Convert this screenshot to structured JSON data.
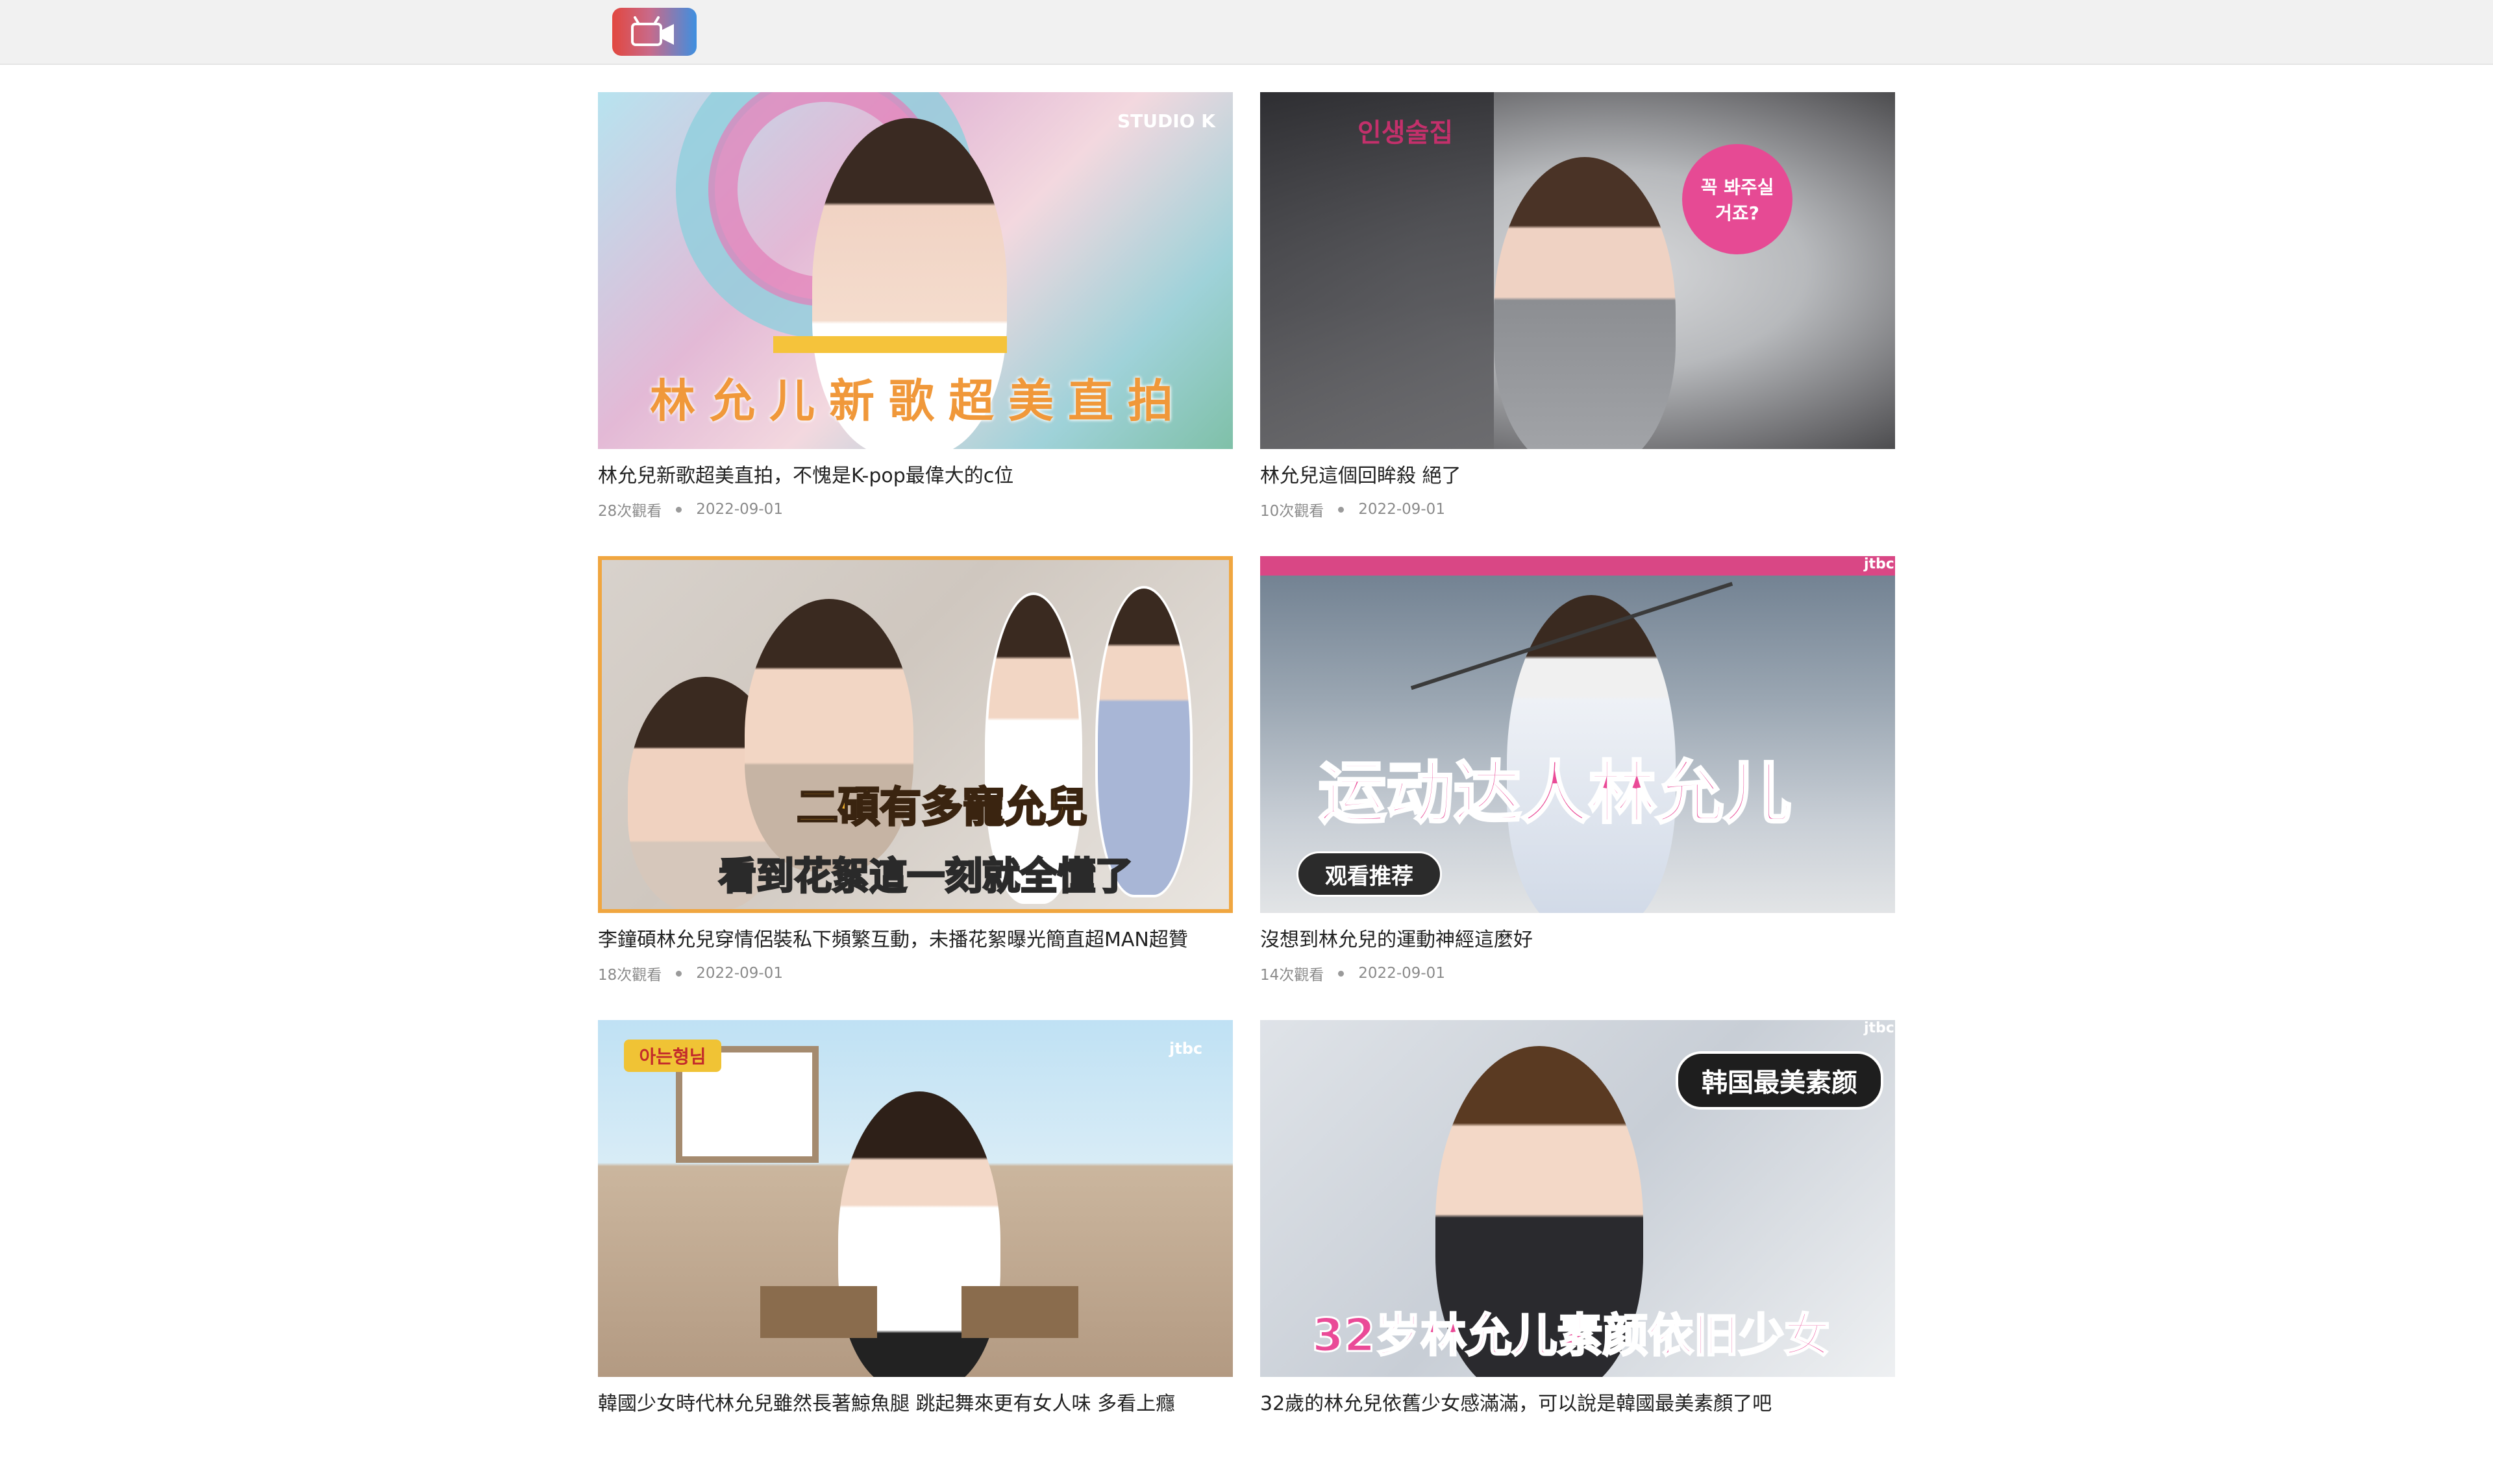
{
  "header": {
    "logo_icon": "video-camera-icon",
    "logo_colors": [
      "#e2473f",
      "#3e8fe0"
    ]
  },
  "videos": [
    {
      "title": "林允兒新歌超美直拍，不愧是K-pop最偉大的c位",
      "views": "28次觀看",
      "date": "2022-09-01",
      "overlay": "林允儿新歌超美直拍",
      "logo_text": "STUDIO K"
    },
    {
      "title": "林允兒這個回眸殺 絕了",
      "views": "10次觀看",
      "date": "2022-09-01",
      "overlay": "인생술집",
      "bubble": "꼭 봐주실 거죠?"
    },
    {
      "title": "李鐘碩林允兒穿情侶裝私下頻繁互動，未播花絮曝光簡直超MAN超贊",
      "views": "18次觀看",
      "date": "2022-09-01",
      "overlay_line1": "二碩有多寵允兒",
      "overlay_line2": "看到花絮這一刻就全懂了"
    },
    {
      "title": "沒想到林允兒的運動神經這麼好",
      "views": "14次觀看",
      "date": "2022-09-01",
      "overlay": "运动达人林允儿",
      "button": "观看推荐",
      "tag": "jtbc"
    },
    {
      "title": "韓國少女時代林允兒雖然長著鯨魚腿 跳起舞來更有女人味 多看上癮",
      "views": "",
      "date": "",
      "tag": "jtbc",
      "badge": "아는형님"
    },
    {
      "title": "32歲的林允兒依舊少女感滿滿，可以說是韓國最美素顏了吧",
      "views": "",
      "date": "",
      "overlay": "32岁林允儿素颜依旧少女",
      "pill": "韩国最美素颜",
      "tag": "jtbc"
    }
  ]
}
